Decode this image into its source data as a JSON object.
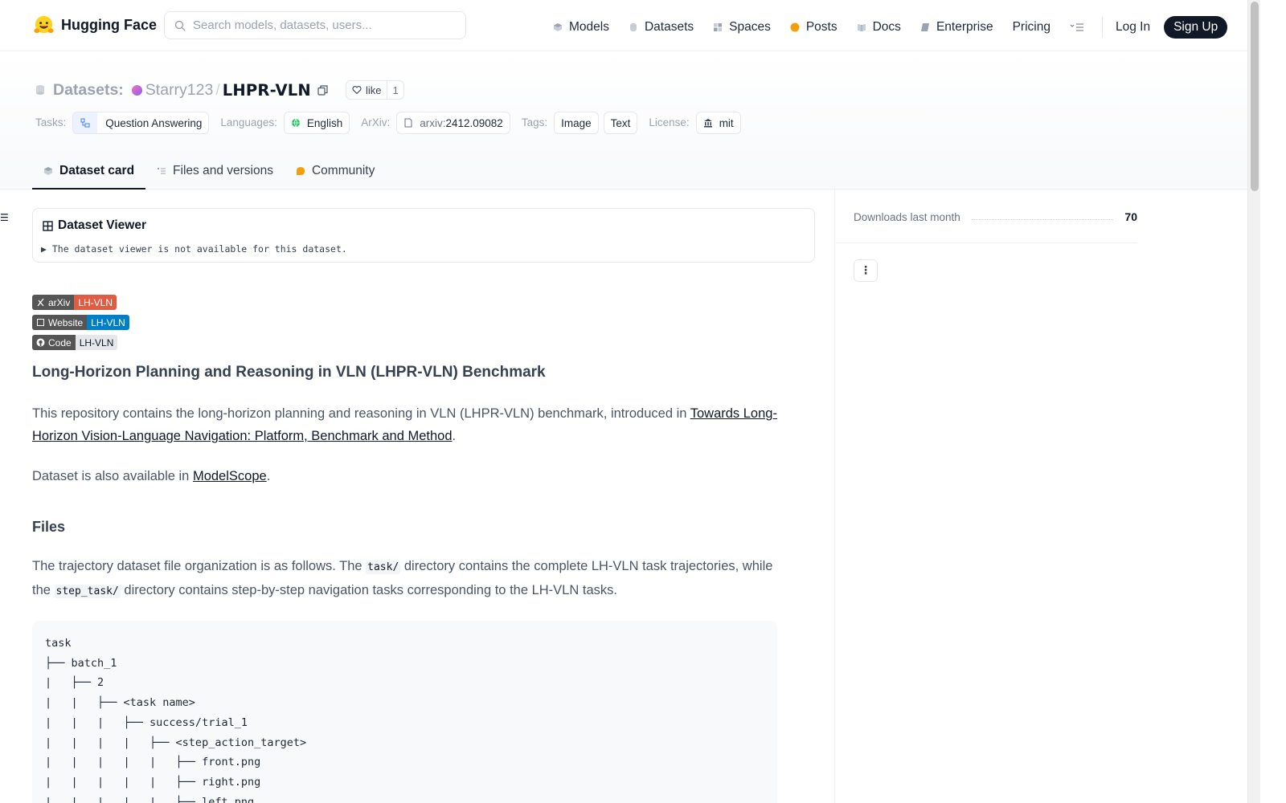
{
  "brand": {
    "name": "Hugging Face"
  },
  "search": {
    "placeholder": "Search models, datasets, users..."
  },
  "nav": {
    "items": [
      "Models",
      "Datasets",
      "Spaces",
      "Posts",
      "Docs",
      "Enterprise",
      "Pricing"
    ],
    "login": "Log In",
    "signup": "Sign Up"
  },
  "repo": {
    "type_label": "Datasets:",
    "owner": "Starry123",
    "separator": "/",
    "name": "LHPR-VLN",
    "like_label": "like",
    "like_count": "1"
  },
  "tags": {
    "tasks_label": "Tasks:",
    "task": "Question Answering",
    "languages_label": "Languages:",
    "language": "English",
    "arxiv_label": "ArXiv:",
    "arxiv_prefix": "arxiv:",
    "arxiv_id": "2412.09082",
    "tags_label": "Tags:",
    "tag_values": [
      "Image",
      "Text"
    ],
    "license_label": "License:",
    "license": "mit"
  },
  "tabs": [
    "Dataset card",
    "Files and versions",
    "Community"
  ],
  "viewer": {
    "title": "Dataset Viewer",
    "note": "▶ The dataset viewer is not available for this dataset."
  },
  "badges": [
    {
      "left": "arXiv",
      "right": "LH-VLN",
      "color": "#e05d44"
    },
    {
      "left": "Website",
      "right": "LH-VLN",
      "color": "#007ec6"
    },
    {
      "left": "Code",
      "right": "LH-VLN",
      "color": "#e5e7eb"
    }
  ],
  "card": {
    "heading": "Long-Horizon Planning and Reasoning in VLN (LHPR-VLN) Benchmark",
    "intro_text": "This repository contains the long-horizon planning and reasoning in VLN (LHPR-VLN) benchmark, introduced in ",
    "intro_link": "Towards Long-Horizon Vision-Language Navigation: Platform, Benchmark and Method",
    "intro_end": ".",
    "also_text": "Dataset is also available in ",
    "also_link": "ModelScope",
    "also_end": ".",
    "files_heading": "Files",
    "files_p1": "The trajectory dataset file organization is as follows. The ",
    "files_code1": "task/",
    "files_p2": " directory contains the complete LH-VLN task trajectories, while the ",
    "files_code2": "step_task/",
    "files_p3": " directory contains step-by-step navigation tasks corresponding to the LH-VLN tasks.",
    "tree": "task\n├── batch_1\n|   ├── 2\n|   |   ├── <task name>\n|   |   |   ├── success/trial_1\n|   |   |   |   ├── <step_action_target>\n|   |   |   |   |   ├── front.png\n|   |   |   |   |   ├── right.png\n|   |   |   |   |   ├── left.png"
  },
  "sidebar": {
    "downloads_label": "Downloads last month",
    "downloads_value": "70",
    "menu_glyph": "⋮"
  },
  "colors": {
    "accent_dark": "#111827",
    "signup_bg": "#111827"
  }
}
